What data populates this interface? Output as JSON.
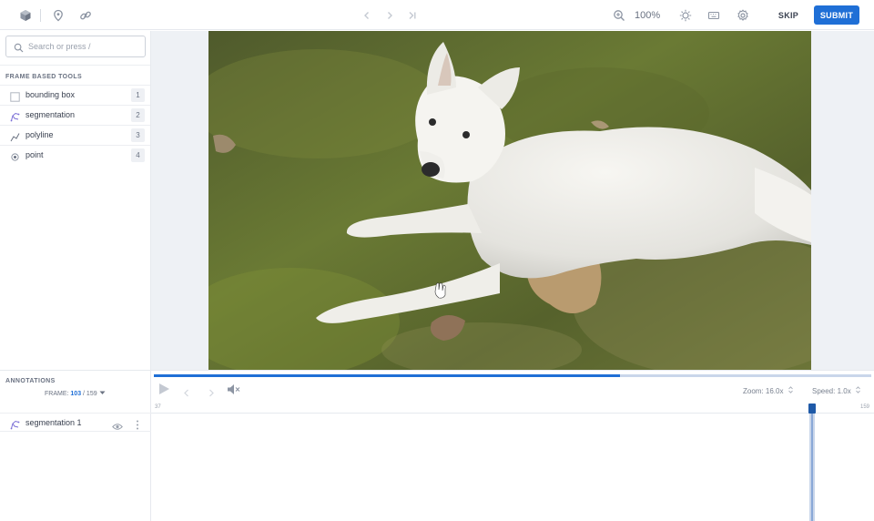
{
  "toolbar": {
    "zoom_level": "100%",
    "skip_label": "SKIP",
    "submit_label": "SUBMIT"
  },
  "search": {
    "placeholder": "Search or press /"
  },
  "tools": {
    "heading": "FRAME BASED TOOLS",
    "items": [
      {
        "label": "bounding box",
        "key": "1",
        "icon": "square-icon"
      },
      {
        "label": "segmentation",
        "key": "2",
        "icon": "segmentation-icon"
      },
      {
        "label": "polyline",
        "key": "3",
        "icon": "polyline-icon"
      },
      {
        "label": "point",
        "key": "4",
        "icon": "point-icon"
      }
    ]
  },
  "annotations": {
    "heading": "ANNOTATIONS",
    "frame_label": "FRAME:",
    "frame_current": "103",
    "frame_total": "/ 159",
    "items": [
      {
        "label": "segmentation 1"
      }
    ]
  },
  "timeline": {
    "zoom": "Zoom: 16.0x",
    "speed": "Speed: 1.0x",
    "start_frame": "37",
    "end_frame": "159",
    "progress": 0.65
  },
  "colors": {
    "accent": "#1f6fd6",
    "segmentation": "#7b6fd6"
  }
}
